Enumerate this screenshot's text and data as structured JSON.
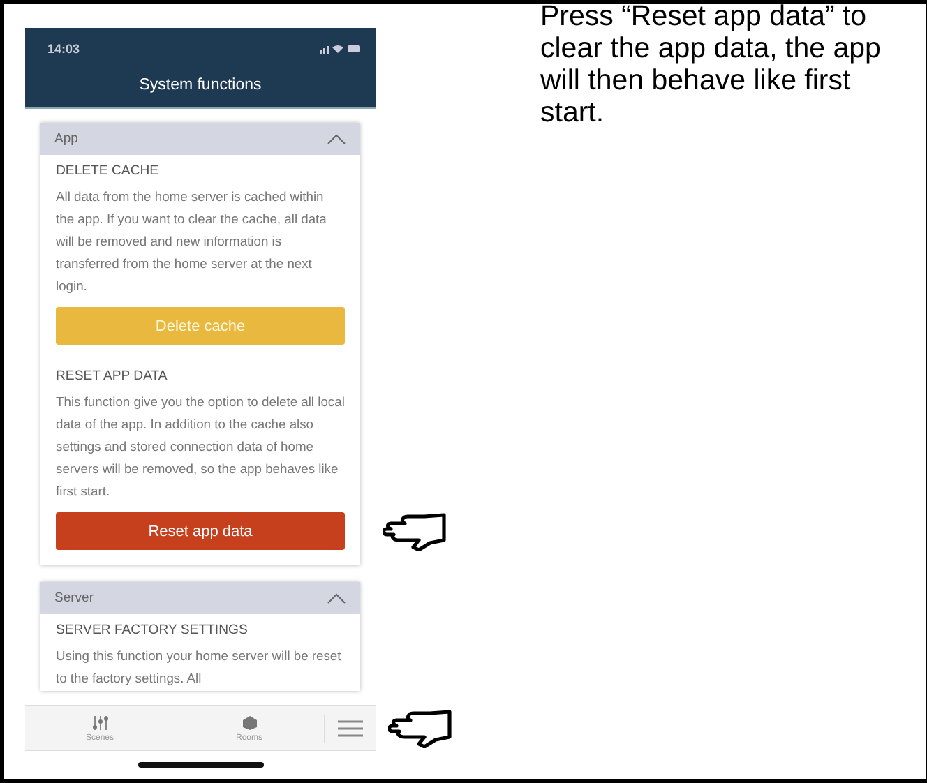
{
  "status_bar": {
    "time": "14:03"
  },
  "header": {
    "title": "System functions"
  },
  "sections": [
    {
      "title": "App",
      "expanded": true,
      "items": [
        {
          "heading": "DELETE CACHE",
          "text": "All data from the home server is cached within the app. If you want to clear the cache, all data will be removed and new information is transferred from the home server at the next login.",
          "button": {
            "label": "Delete cache",
            "kind": "warning"
          },
          "pointer": false
        },
        {
          "heading": "RESET APP DATA",
          "text": "This function give you the option to delete all local data of the app. In addition to the cache also settings and stored connection data of home servers will be removed, so the app behaves like first start.",
          "button": {
            "label": "Reset app data",
            "kind": "danger"
          },
          "pointer": true
        }
      ]
    },
    {
      "title": "Server",
      "expanded": true,
      "items": [
        {
          "heading": "SERVER FACTORY SETTINGS",
          "text": "Using this function your home server will be reset to the factory settings. All",
          "pointer": false
        }
      ]
    }
  ],
  "tab_bar": [
    {
      "label": "Scenes",
      "kind": "scenes"
    },
    {
      "label": "Rooms",
      "kind": "rooms"
    },
    {
      "kind": "menu",
      "pointer": true
    }
  ],
  "instruction": "Press “Reset app data” to clear the app data, the app will then behave like first start."
}
